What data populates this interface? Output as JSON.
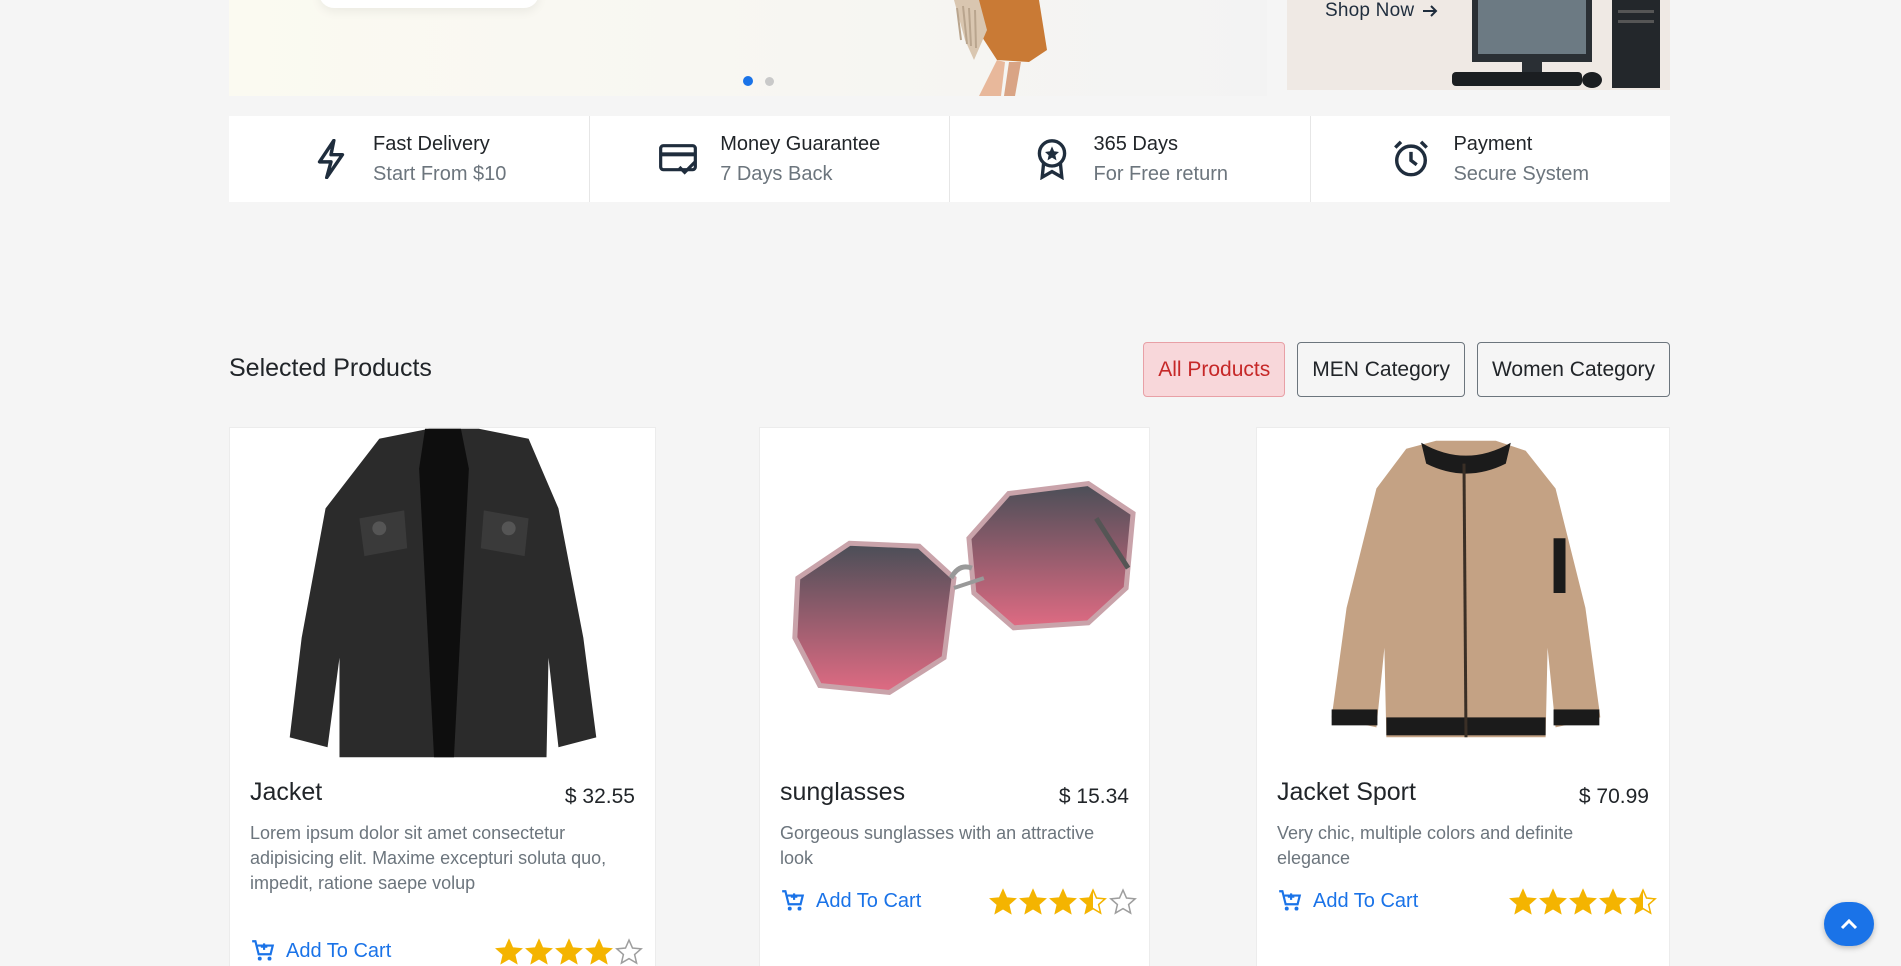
{
  "hero": {
    "shop_now_label": "Shop Now",
    "slide_count": 2,
    "active_slide": 1
  },
  "features": [
    {
      "icon": "lightning-icon",
      "title": "Fast Delivery",
      "subtitle": "Start From $10"
    },
    {
      "icon": "credit-card-check-icon",
      "title": "Money Guarantee",
      "subtitle": "7 Days Back"
    },
    {
      "icon": "award-badge-icon",
      "title": "365 Days",
      "subtitle": "For Free return"
    },
    {
      "icon": "alarm-clock-icon",
      "title": "Payment",
      "subtitle": "Secure System"
    }
  ],
  "products_section": {
    "title": "Selected Products",
    "filters": [
      {
        "label": "All Products",
        "active": true
      },
      {
        "label": "MEN Category",
        "active": false
      },
      {
        "label": "Women Category",
        "active": false
      }
    ]
  },
  "products": [
    {
      "name": "Jacket",
      "price": "$ 32.55",
      "description": "Lorem ipsum dolor sit amet consectetur adipisicing elit. Maxime excepturi soluta quo, impedit, ratione saepe volup",
      "cart_label": "Add To Cart",
      "rating": 4
    },
    {
      "name": "sunglasses",
      "price": "$ 15.34",
      "description": "Gorgeous sunglasses with an attractive look",
      "cart_label": "Add To Cart",
      "rating": 3.5
    },
    {
      "name": "Jacket Sport",
      "price": "$ 70.99",
      "description": "Very chic, multiple colors and definite elegance",
      "cart_label": "Add To Cart",
      "rating": 4.5
    }
  ],
  "colors": {
    "accent": "#1a73e8",
    "star": "#f4b400",
    "active_filter_bg": "#f8d7da",
    "active_filter_text": "#c62828"
  }
}
